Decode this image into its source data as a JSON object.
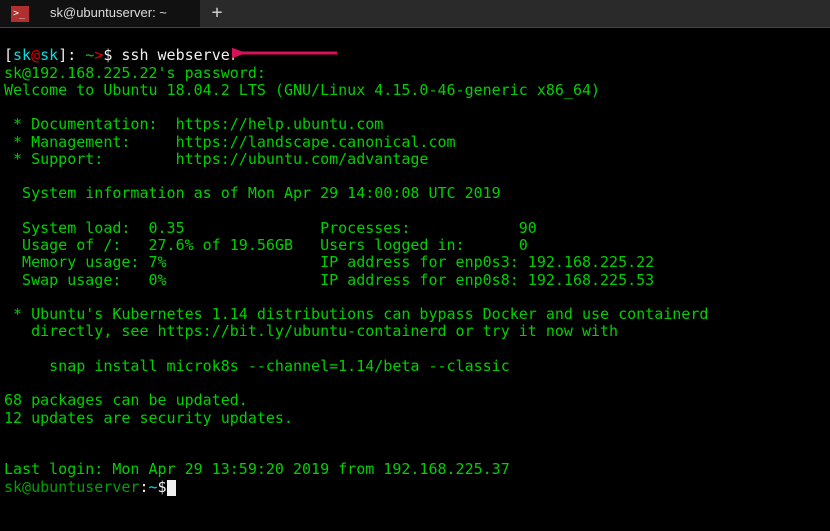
{
  "tabbar": {
    "icon_glyph": ">_",
    "title": "sk@ubuntuserver: ~",
    "new_tab": "+"
  },
  "prompt1": {
    "open": "[",
    "user": "sk",
    "at": "@",
    "host": "sk",
    "close": "]",
    "path_sep": ": ",
    "path": "~",
    "marker": ">",
    "dollar": "$ ",
    "cmd": "ssh webserver"
  },
  "lines": {
    "pwprompt": "sk@192.168.225.22's password:",
    "welcome": "Welcome to Ubuntu 18.04.2 LTS (GNU/Linux 4.15.0-46-generic x86_64)",
    "blank": "",
    "doc": " * Documentation:  https://help.ubuntu.com",
    "mgmt": " * Management:     https://landscape.canonical.com",
    "supp": " * Support:        https://ubuntu.com/advantage",
    "sysinfo": "  System information as of Mon Apr 29 14:00:08 UTC 2019",
    "row1": "  System load:  0.35               Processes:            90",
    "row2": "  Usage of /:   27.6% of 19.56GB   Users logged in:      0",
    "row3": "  Memory usage: 7%                 IP address for enp0s3: 192.168.225.22",
    "row4": "  Swap usage:   0%                 IP address for enp0s8: 192.168.225.53",
    "k8s1": " * Ubuntu's Kubernetes 1.14 distributions can bypass Docker and use containerd",
    "k8s2": "   directly, see https://bit.ly/ubuntu-containerd or try it now with",
    "snap": "     snap install microk8s --channel=1.14/beta --classic",
    "pkg1": "68 packages can be updated.",
    "pkg2": "12 updates are security updates.",
    "last": "Last login: Mon Apr 29 13:59:20 2019 from 192.168.225.37"
  },
  "prompt2": {
    "user_host": "sk@ubuntuserver",
    "colon": ":",
    "path": "~",
    "dollar": "$"
  },
  "arrow_color": "#d8115b"
}
